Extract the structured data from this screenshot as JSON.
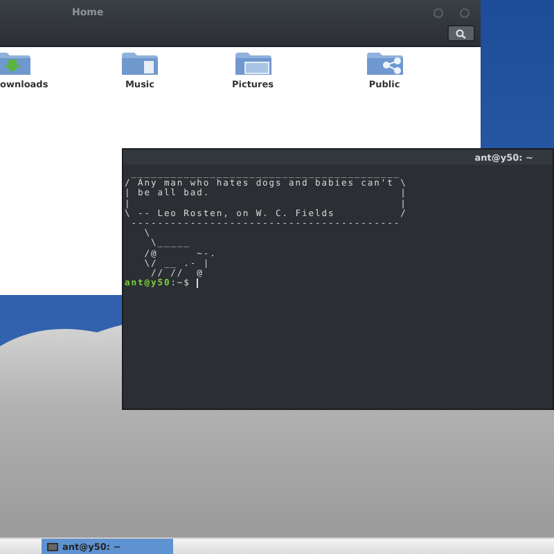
{
  "file_manager": {
    "title": "Home",
    "folders": [
      {
        "label": "ownloads",
        "kind": "downloads"
      },
      {
        "label": "Music",
        "kind": "music"
      },
      {
        "label": "Pictures",
        "kind": "pictures"
      },
      {
        "label": "Public",
        "kind": "public"
      }
    ]
  },
  "terminal": {
    "title": "ant@y50: ~",
    "lines": [
      " _________________________________________",
      "/ Any man who hates dogs and babies can't \\",
      "| be all bad.                             |",
      "|                                         |",
      "\\ -- Leo Rosten, on W. C. Fields          /",
      " -----------------------------------------",
      "   \\",
      "    \\_____",
      "   /@      ~-.",
      "   \\/ __ .- |",
      "    // //  @"
    ],
    "prompt_user": "ant@y50",
    "prompt_path": ":~$ "
  },
  "taskbar": {
    "items": [
      {
        "label": "ant@y50: ~",
        "selected": true
      }
    ]
  }
}
